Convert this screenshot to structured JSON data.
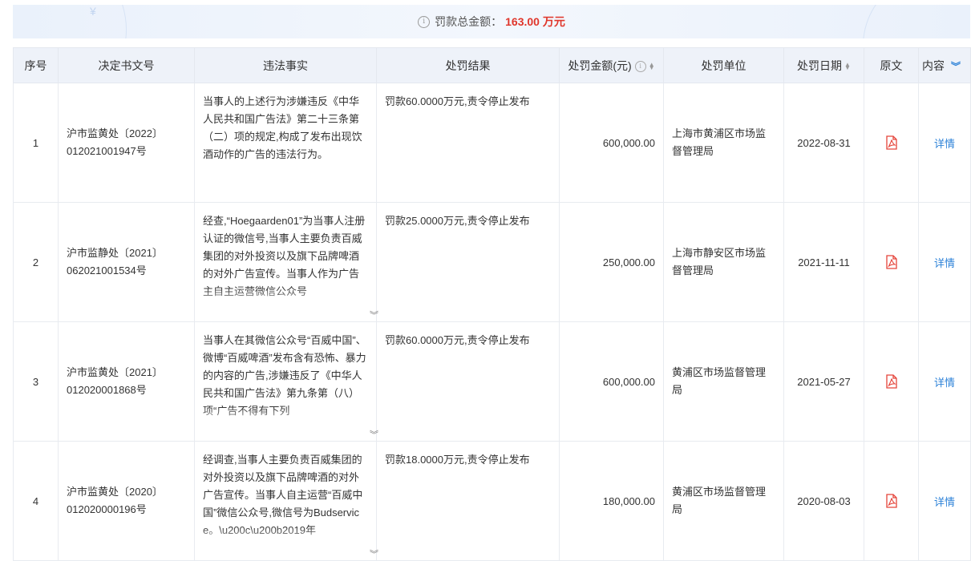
{
  "summary": {
    "label": "罚款总金额：",
    "amount": "163.00 万元"
  },
  "columns": {
    "idx": "序号",
    "doc": "决定书文号",
    "fact": "违法事实",
    "result": "处罚结果",
    "amount": "处罚金额(元)",
    "org": "处罚单位",
    "date": "处罚日期",
    "original": "原文",
    "content": "内容"
  },
  "rows": [
    {
      "idx": "1",
      "doc": "沪市监黄处〔2022〕012021001947号",
      "fact": "当事人的上述行为涉嫌违反《中华人民共和国广告法》第二十三条第（二）项的规定,构成了发布出现饮酒动作的广告的违法行为。",
      "result": "罚款60.0000万元,责令停止发布",
      "amount": "600,000.00",
      "org": "上海市黄浦区市场监督管理局",
      "date": "2022-08-31",
      "detail": "详情"
    },
    {
      "idx": "2",
      "doc": "沪市监静处〔2021〕062021001534号",
      "fact": "经查,“Hoegaarden01”为当事人注册认证的微信号,当事人主要负责百威集团的对外投资以及旗下品牌啤酒的对外广告宣传。当事人作为广告主自主运营微信公众号",
      "result": "罚款25.0000万元,责令停止发布",
      "amount": "250,000.00",
      "org": "上海市静安区市场监督管理局",
      "date": "2021-11-11",
      "detail": "详情"
    },
    {
      "idx": "3",
      "doc": "沪市监黄处〔2021〕012020001868号",
      "fact": "当事人在其微信公众号“百威中国”、微博“百威啤酒”发布含有恐怖、暴力的内容的广告,涉嫌违反了《中华人民共和国广告法》第九条第（八）项“广告不得有下列",
      "result": "罚款60.0000万元,责令停止发布",
      "amount": "600,000.00",
      "org": "黄浦区市场监督管理局",
      "date": "2021-05-27",
      "detail": "详情"
    },
    {
      "idx": "4",
      "doc": "沪市监黄处〔2020〕012020000196号",
      "fact": "经调查,当事人主要负责百威集团的对外投资以及旗下品牌啤酒的对外广告宣传。当事人自主运营“百威中国”微信公众号,微信号为Budservice。\\u200c\\u200b2019年",
      "result": "罚款18.0000万元,责令停止发布",
      "amount": "180,000.00",
      "org": "黄浦区市场监督管理局",
      "date": "2020-08-03",
      "detail": "详情"
    }
  ],
  "colors": {
    "accent": "#2d82d8",
    "amount_red": "#e0362b",
    "header_bg": "#eef2f9",
    "pdf_red": "#e5443a"
  },
  "icons": {
    "info": "info-circle-icon",
    "sort": "sort-icon",
    "expand": "chevron-double-down-icon",
    "pdf": "pdf-icon"
  }
}
